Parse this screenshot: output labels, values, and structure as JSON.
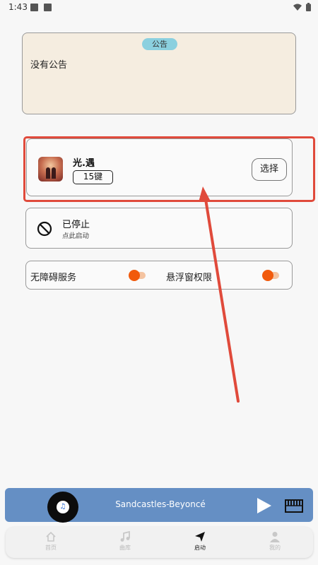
{
  "status_bar": {
    "time": "1:43"
  },
  "notice": {
    "tag": "公告",
    "text": "没有公告"
  },
  "game": {
    "title": "光.遇",
    "keys": "15键",
    "select_label": "选择"
  },
  "service_status": {
    "title": "已停止",
    "subtitle": "点此启动"
  },
  "permissions": {
    "accessibility_label": "无障碍服务",
    "overlay_label": "悬浮窗权限"
  },
  "player": {
    "song": "Sandcastles-Beyoncé"
  },
  "tabs": [
    {
      "label": "首页",
      "icon": "home-icon",
      "active": false
    },
    {
      "label": "曲库",
      "icon": "music-note-icon",
      "active": false
    },
    {
      "label": "启动",
      "icon": "send-icon",
      "active": true
    },
    {
      "label": "我的",
      "icon": "person-icon",
      "active": false
    }
  ],
  "colors": {
    "accent_orange": "#f15a0c",
    "player_blue": "#658fc4",
    "annotation_red": "#e04a3b",
    "notice_bg": "#f5ede0",
    "tag_blue": "#8bd0df"
  }
}
